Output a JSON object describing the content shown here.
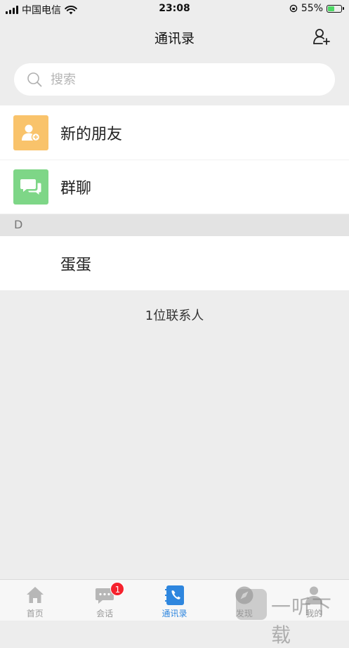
{
  "status_bar": {
    "carrier": "中国电信",
    "time": "23:08",
    "battery_percent": "55%",
    "battery_level": 0.55
  },
  "nav": {
    "title": "通讯录",
    "add_icon": "add-contact-icon"
  },
  "search": {
    "placeholder": "搜索",
    "icon": "search-icon"
  },
  "entries": [
    {
      "label": "新的朋友",
      "icon": "new-friend-icon",
      "color": "#f9c36b"
    },
    {
      "label": "群聊",
      "icon": "group-chat-icon",
      "color": "#7ed687"
    }
  ],
  "sections": [
    {
      "letter": "D",
      "contacts": [
        {
          "name": "蛋蛋"
        }
      ]
    }
  ],
  "contact_count": "1位联系人",
  "tabs": [
    {
      "label": "首页",
      "icon": "home-icon",
      "active": false
    },
    {
      "label": "会话",
      "icon": "chat-icon",
      "active": false,
      "badge": "1"
    },
    {
      "label": "通讯录",
      "icon": "contacts-icon",
      "active": true
    },
    {
      "label": "发现",
      "icon": "discover-icon",
      "active": false
    },
    {
      "label": "我的",
      "icon": "profile-icon",
      "active": false
    }
  ],
  "watermark": {
    "text": "一听下载"
  },
  "colors": {
    "accent": "#2e86de",
    "badge": "#f5222d",
    "background": "#ededed"
  }
}
